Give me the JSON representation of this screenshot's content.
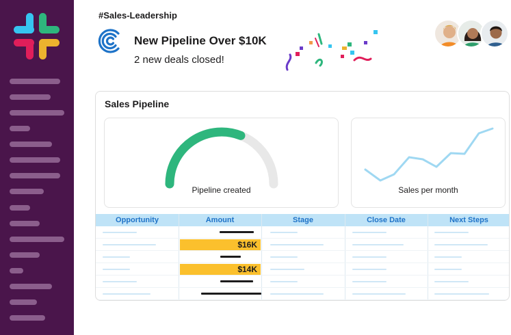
{
  "channel": {
    "name": "#Sales-Leadership"
  },
  "notification": {
    "title": "New Pipeline Over $10K",
    "subtitle": "2 new deals closed!"
  },
  "icons": {
    "app_logo": "slack-logo-icon",
    "notif_logo": "concentric-c-logo-icon"
  },
  "colors": {
    "sidebar": "#4a154b",
    "gauge": "#2eb67d",
    "line": "#9fd8f2",
    "header_bg": "#bfe3f7",
    "header_text": "#1e73c8",
    "highlight": "#fbc02d"
  },
  "card": {
    "title": "Sales Pipeline",
    "gauge": {
      "label": "Pipeline created",
      "value": 0.62
    },
    "line_panel": {
      "label": "Sales per month"
    }
  },
  "table": {
    "headers": [
      "Opportunity",
      "Amount",
      "Stage",
      "Close Date",
      "Next Steps"
    ],
    "rows": [
      {
        "amount": ""
      },
      {
        "amount": "$16K"
      },
      {
        "amount": ""
      },
      {
        "amount": "$14K"
      },
      {
        "amount": ""
      },
      {
        "amount": ""
      }
    ]
  }
}
